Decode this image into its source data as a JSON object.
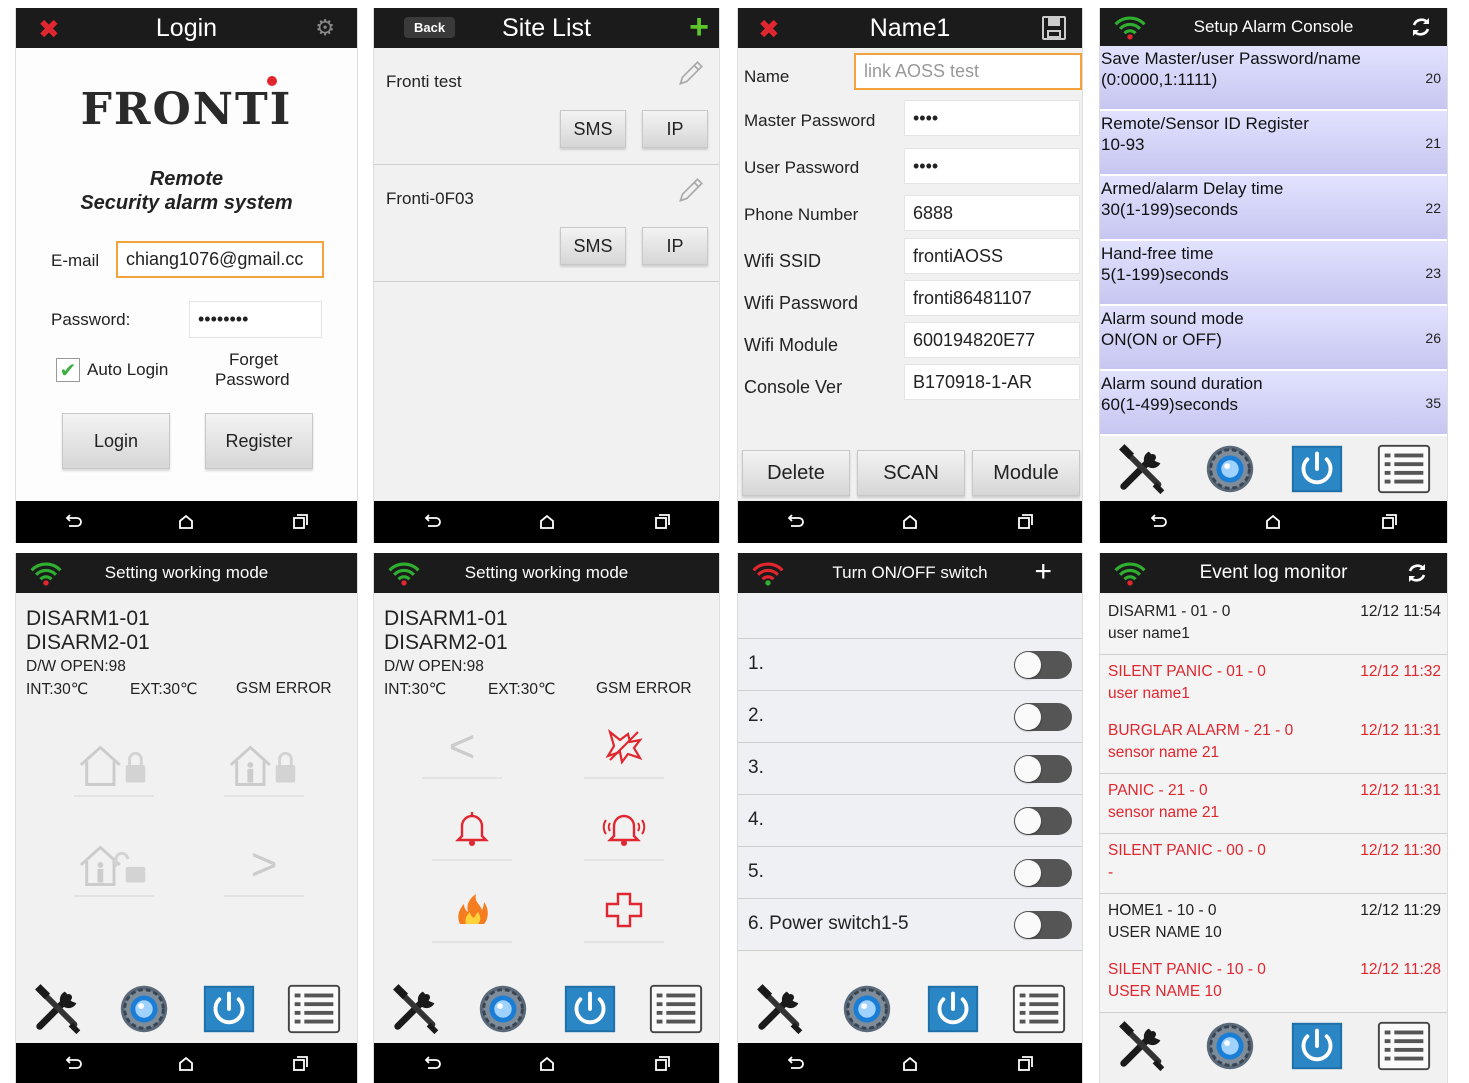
{
  "colors": {
    "header": "#1b1b1b",
    "accent_red": "#e0262e",
    "focus_border": "#f2a33a",
    "panel_blue": "#c6c6f1",
    "green_plus": "#5cc52c"
  },
  "login": {
    "title": "Login",
    "logo": "FRONTI",
    "subtitle_1": "Remote",
    "subtitle_2": "Security alarm system",
    "email_label": "E-mail",
    "email_value": "chiang1076@gmail.cc",
    "password_label": "Password:",
    "password_value": "••••••••",
    "auto_login": "Auto Login",
    "forget_1": "Forget",
    "forget_2": "Password",
    "login_btn": "Login",
    "register_btn": "Register"
  },
  "sitelist": {
    "back": "Back",
    "title": "Site List",
    "sites": [
      {
        "name": "Fronti test",
        "sms": "SMS",
        "ip": "IP"
      },
      {
        "name": "Fronti-0F03",
        "sms": "SMS",
        "ip": "IP"
      }
    ]
  },
  "name1": {
    "title": "Name1",
    "fields": [
      {
        "label": "Name",
        "value": "",
        "placeholder": "link AOSS test"
      },
      {
        "label": "Master Password",
        "value": "••••"
      },
      {
        "label": "User Password",
        "value": "••••"
      },
      {
        "label": "Phone Number",
        "value": "6888"
      },
      {
        "label": "Wifi SSID",
        "value": "frontiAOSS"
      },
      {
        "label": "Wifi Password",
        "value": "fronti86481107"
      },
      {
        "label": "Wifi Module",
        "value": "600194820E77"
      },
      {
        "label": "Console Ver",
        "value": "B170918-1-AR"
      }
    ],
    "delete_btn": "Delete",
    "scan_btn": "SCAN",
    "module_btn": "Module"
  },
  "setup": {
    "title": "Setup Alarm Console",
    "rows": [
      {
        "line1": "Save Master/user Password/name",
        "line2": "(0:0000,1:1111)",
        "num": "20"
      },
      {
        "line1": "Remote/Sensor ID Register",
        "line2": "10-93",
        "num": "21"
      },
      {
        "line1": "Armed/alarm Delay time",
        "line2": "30(1-199)seconds",
        "num": "22"
      },
      {
        "line1": "Hand-free time",
        "line2": "5(1-199)seconds",
        "num": "23"
      },
      {
        "line1": "Alarm sound mode",
        "line2": "ON(ON or OFF)",
        "num": "26"
      },
      {
        "line1": "Alarm sound duration",
        "line2": "60(1-499)seconds",
        "num": "35"
      }
    ]
  },
  "mode": {
    "title": "Setting working mode",
    "line1": "DISARM1-01",
    "line2": "DISARM2-01",
    "dw": "D/W OPEN:98",
    "int": "INT:30℃",
    "ext": "EXT:30℃",
    "gsm": "GSM ERROR"
  },
  "switch": {
    "title": "Turn ON/OFF switch",
    "items": [
      "1.",
      "2.",
      "3.",
      "4.",
      "5.",
      "6. Power switch1-5"
    ]
  },
  "eventlog": {
    "title": "Event log monitor",
    "events": [
      {
        "event": "DISARM1 - 01 - 0",
        "user": "user name1",
        "time": "12/12 11:54",
        "red": false
      },
      {
        "event": "SILENT PANIC - 01 - 0",
        "user": "user name1",
        "time": "12/12 11:32",
        "red": true
      },
      {
        "event": "BURGLAR ALARM - 21 - 0",
        "user": "sensor name 21",
        "time": "12/12 11:31",
        "red": true
      },
      {
        "event": "PANIC - 21 - 0",
        "user": "sensor name 21",
        "time": "12/12 11:31",
        "red": true
      },
      {
        "event": "SILENT PANIC - 00 - 0",
        "user": "-",
        "time": "12/12 11:30",
        "red": true
      },
      {
        "event": "HOME1 - 10 - 0",
        "user": "USER NAME 10",
        "time": "12/12 11:29",
        "red": false
      },
      {
        "event": "SILENT PANIC - 10 - 0",
        "user": "USER NAME 10",
        "time": "12/12 11:28",
        "red": true
      }
    ]
  },
  "icons": [
    "close-icon",
    "gear-icon",
    "pencil-icon",
    "plus-icon",
    "save-icon",
    "refresh-icon",
    "wifi-icon",
    "tools-icon",
    "settings-icon",
    "power-icon",
    "list-icon",
    "back-icon",
    "home-icon",
    "recent-apps-icon"
  ]
}
